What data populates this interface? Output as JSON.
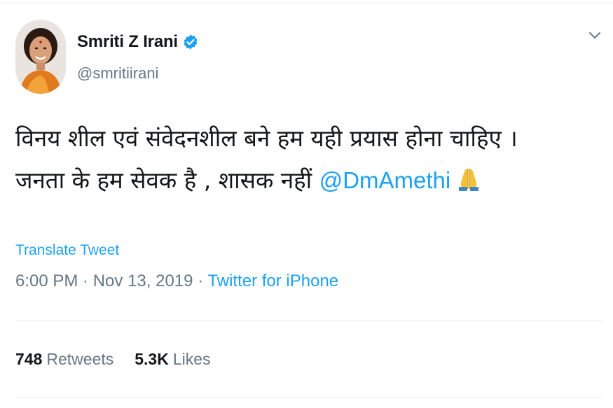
{
  "author": {
    "display_name": "Smriti Z Irani",
    "handle": "@smritiirani",
    "verified": true,
    "avatar_icon": "profile-photo"
  },
  "tweet": {
    "line1": "विनय शील एवं संवेदनशील बने हम यही प्रयास होना चाहिए ।",
    "line2_text": "जनता के हम सेवक है , शासक नहीं ",
    "mention": "@DmAmethi",
    "emoji_icon": "folded-hands-icon"
  },
  "translate_label": "Translate Tweet",
  "meta": {
    "time": "6:00 PM",
    "separator": " · ",
    "date": "Nov 13, 2019",
    "source": "Twitter for iPhone"
  },
  "stats": {
    "retweets_count": "748",
    "retweets_label": "Retweets",
    "likes_count": "5.3K",
    "likes_label": "Likes"
  },
  "colors": {
    "link": "#1da1f2",
    "text": "#14171a",
    "muted": "#657786",
    "border": "#e6ecf0"
  }
}
